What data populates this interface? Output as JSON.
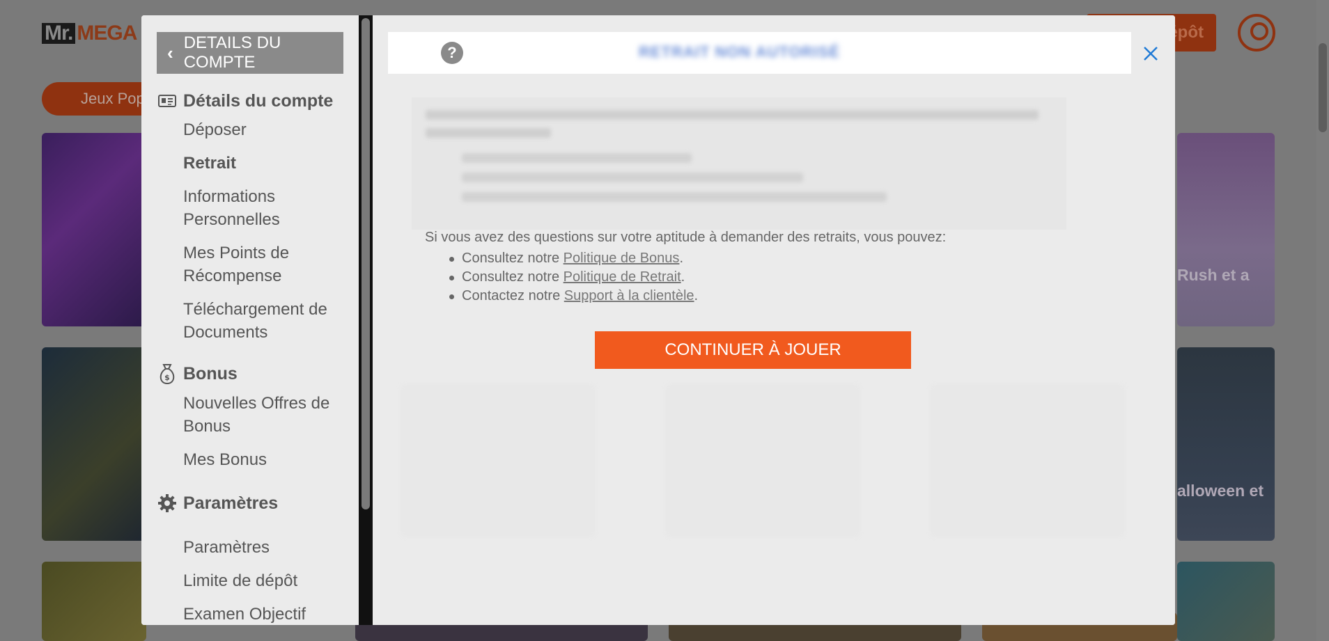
{
  "site": {
    "logo_mr": "Mr.",
    "logo_mega": "MEGA",
    "deposit_label": "Dépôt",
    "pill_label": "Jeux Pop",
    "tile_captions": [
      "Rush et a",
      "alloween et"
    ]
  },
  "sidebar": {
    "header": "DETAILS DU COMPTE",
    "sections": [
      {
        "title": "Détails du compte",
        "icon": "id-card-icon",
        "items": [
          "Déposer",
          "Retrait",
          "Informations Personnelles",
          "Mes Points de Récompense",
          "Téléchargement de Documents"
        ]
      },
      {
        "title": "Bonus",
        "icon": "money-bag-icon",
        "items": [
          "Nouvelles Offres de Bonus",
          "Mes Bonus"
        ]
      },
      {
        "title": "Paramètres",
        "icon": "gear-icon",
        "items": [
          "Paramètres",
          "Limite de dépôt",
          "Examen Objectif"
        ]
      }
    ],
    "active_item": "Retrait"
  },
  "content": {
    "title_blurred": "RETRAIT NON AUTORISÉ",
    "question_text": "Si vous avez des questions sur votre aptitude à demander des retraits, vous pouvez:",
    "links": [
      {
        "prefix": "Consultez notre ",
        "link": "Politique de Bonus",
        "suffix": "."
      },
      {
        "prefix": "Consultez notre ",
        "link": "Politique de Retrait",
        "suffix": "."
      },
      {
        "prefix": "Contactez notre ",
        "link": "Support à la clientèle",
        "suffix": "."
      }
    ],
    "continue_button": "CONTINUER À JOUER"
  },
  "colors": {
    "accent": "#f15a1e",
    "link_close": "#1f7ad6"
  }
}
